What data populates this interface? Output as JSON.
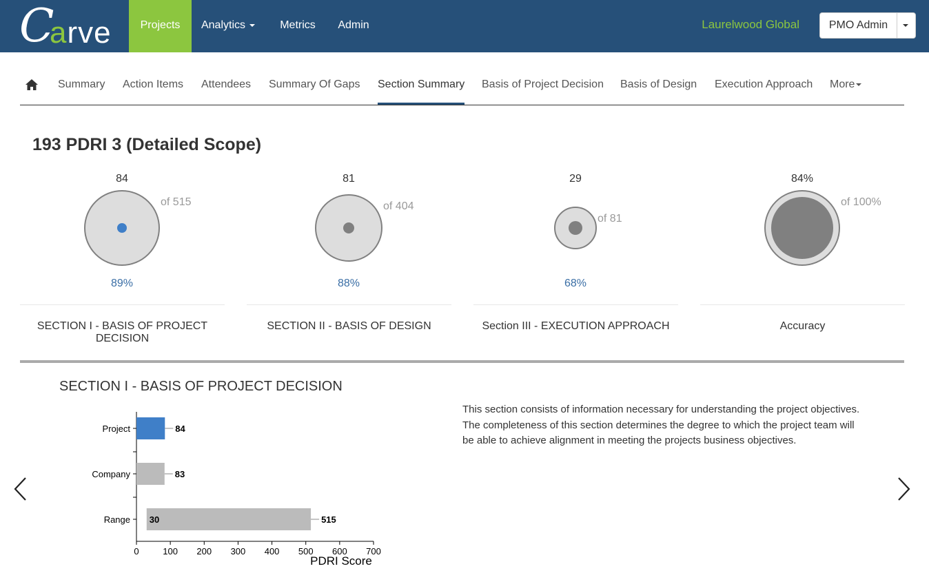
{
  "nav": {
    "logo": {
      "c": "C",
      "rest_a": "a",
      "rest": "rve"
    },
    "items": [
      {
        "label": "Projects",
        "active": true
      },
      {
        "label": "Analytics",
        "dropdown": true
      },
      {
        "label": "Metrics"
      },
      {
        "label": "Admin"
      }
    ],
    "company": "Laurelwood Global",
    "user": "PMO Admin"
  },
  "subnav": {
    "items": [
      {
        "label": "Summary"
      },
      {
        "label": "Action Items"
      },
      {
        "label": "Attendees"
      },
      {
        "label": "Summary Of Gaps"
      },
      {
        "label": "Section Summary",
        "active": true
      },
      {
        "label": "Basis of Project Decision"
      },
      {
        "label": "Basis of Design"
      },
      {
        "label": "Execution Approach"
      },
      {
        "label": "More"
      }
    ]
  },
  "page_title": "193 PDRI 3 (Detailed Scope)",
  "tiles": [
    {
      "value": "84",
      "of": "of 515",
      "pct": "89%",
      "title": "SECTION I - BASIS OF PROJECT DECISION",
      "score": 84,
      "max": 515,
      "dot_color": "#3f7fc8"
    },
    {
      "value": "81",
      "of": "of 404",
      "pct": "88%",
      "title": "SECTION II - BASIS OF DESIGN",
      "score": 81,
      "max": 404,
      "dot_color": "#808080"
    },
    {
      "value": "29",
      "of": "of 81",
      "pct": "68%",
      "title": "Section III - EXECUTION APPROACH",
      "score": 29,
      "max": 81,
      "dot_color": "#808080"
    },
    {
      "value": "84%",
      "of": "of 100%",
      "pct": "",
      "title": "Accuracy",
      "score": 84,
      "max": 100,
      "dot_color": "#808080"
    }
  ],
  "detail": {
    "title": "SECTION I - BASIS OF PROJECT DECISION",
    "description": "This section consists of information necessary for understanding the project objectives. The completeness of this section determines the degree to which the project team will be able to achieve alignment in meeting the projects business objectives."
  },
  "chart_data": {
    "type": "bar",
    "orientation": "horizontal",
    "categories": [
      "Project",
      "Company",
      "Range"
    ],
    "values": [
      84,
      83,
      515
    ],
    "range_min": 30,
    "value_labels": [
      "84",
      "83",
      "515"
    ],
    "range_min_label": "30",
    "xlabel": "PDRI Score",
    "xlim": [
      0,
      700
    ],
    "xticks": [
      0,
      100,
      200,
      300,
      400,
      500,
      600,
      700
    ],
    "colors": {
      "Project": "#3f7fc8",
      "Company": "#bbbbbb",
      "Range": "#bbbbbb"
    }
  },
  "colors": {
    "navbar": "#265079",
    "accent": "#8cc63f",
    "pct_text": "#3a6ea5"
  }
}
